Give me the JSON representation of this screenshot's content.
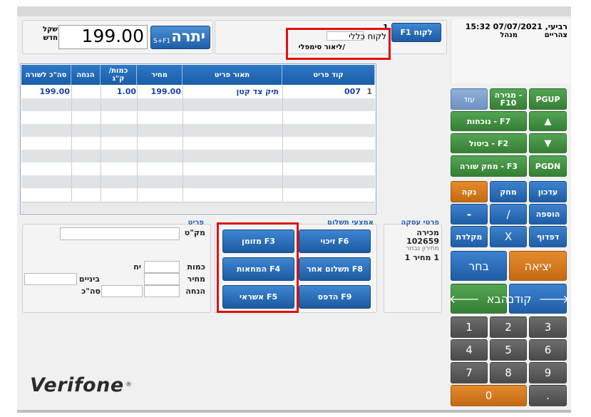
{
  "balance": {
    "currency": "שקל חדש",
    "amount": "199.00",
    "label": "יתרה",
    "shortcut": "S+F1"
  },
  "customer": {
    "button": "F1 לקוח",
    "row_num": "1",
    "type": "לקוח כללי",
    "name": "/ליאור סימפלי"
  },
  "header": {
    "datetime": "15:32 07/07/2021 ,רביעי",
    "shift": "צהריים",
    "role": "מנהל"
  },
  "table": {
    "columns": [
      "קוד פריט",
      "תאור פריט",
      "מחיר",
      "כמות/ ק\"ג",
      "הנחה",
      "סה\"כ לשורה"
    ],
    "rows": [
      {
        "num": "1",
        "code": "007",
        "desc": "תיק צד קטן",
        "price": "199.00",
        "qty": "1.00",
        "discount": "",
        "total": "199.00"
      }
    ]
  },
  "item": {
    "title": "פריט",
    "sku_label": "מק\"ט",
    "qty_label": "כמות",
    "qty_unit": "יח",
    "price_label": "מחיר",
    "discount_label": "הנחה",
    "sub_label": "ביניים",
    "total_label": "סה\"כ"
  },
  "payments": {
    "title": "אמצעי תשלום",
    "credit": "זיכוי F6",
    "cash": "מזומן F3",
    "other": "תשלום אחר F8",
    "cheques": "המחאות F4",
    "print": "הדפס F9",
    "card": "אשראי F5"
  },
  "transaction": {
    "title": "פרטי עסקה",
    "type": "מכירה",
    "number": "102659",
    "pricelist_label": "מחירון נבחר",
    "pricelist": "1 מחיר 1"
  },
  "keys": {
    "more": "עוד",
    "drawer": "מגירה - F10",
    "pgup": "PGUP",
    "stock": "נוכחות - F7",
    "up": "▲",
    "cancel": "ביטול - F2",
    "down": "▼",
    "delete_row": "מחק שורה - F3",
    "pgdn": "PGDN",
    "clear": "נקה",
    "erase": "מחק",
    "update": "עדכון",
    "minus": "-",
    "slash": "/",
    "add": "הוספה",
    "keyboard": "מקלדת",
    "times": "X",
    "browse": "דפדוף",
    "select": "בחר",
    "exit": "יציאה",
    "next": "הבא",
    "prev": "קודם",
    "n1": "1",
    "n2": "2",
    "n3": "3",
    "n4": "4",
    "n5": "5",
    "n6": "6",
    "n7": "7",
    "n8": "8",
    "n9": "9",
    "n0": "0",
    "dot": "."
  },
  "brand": "Verifone"
}
